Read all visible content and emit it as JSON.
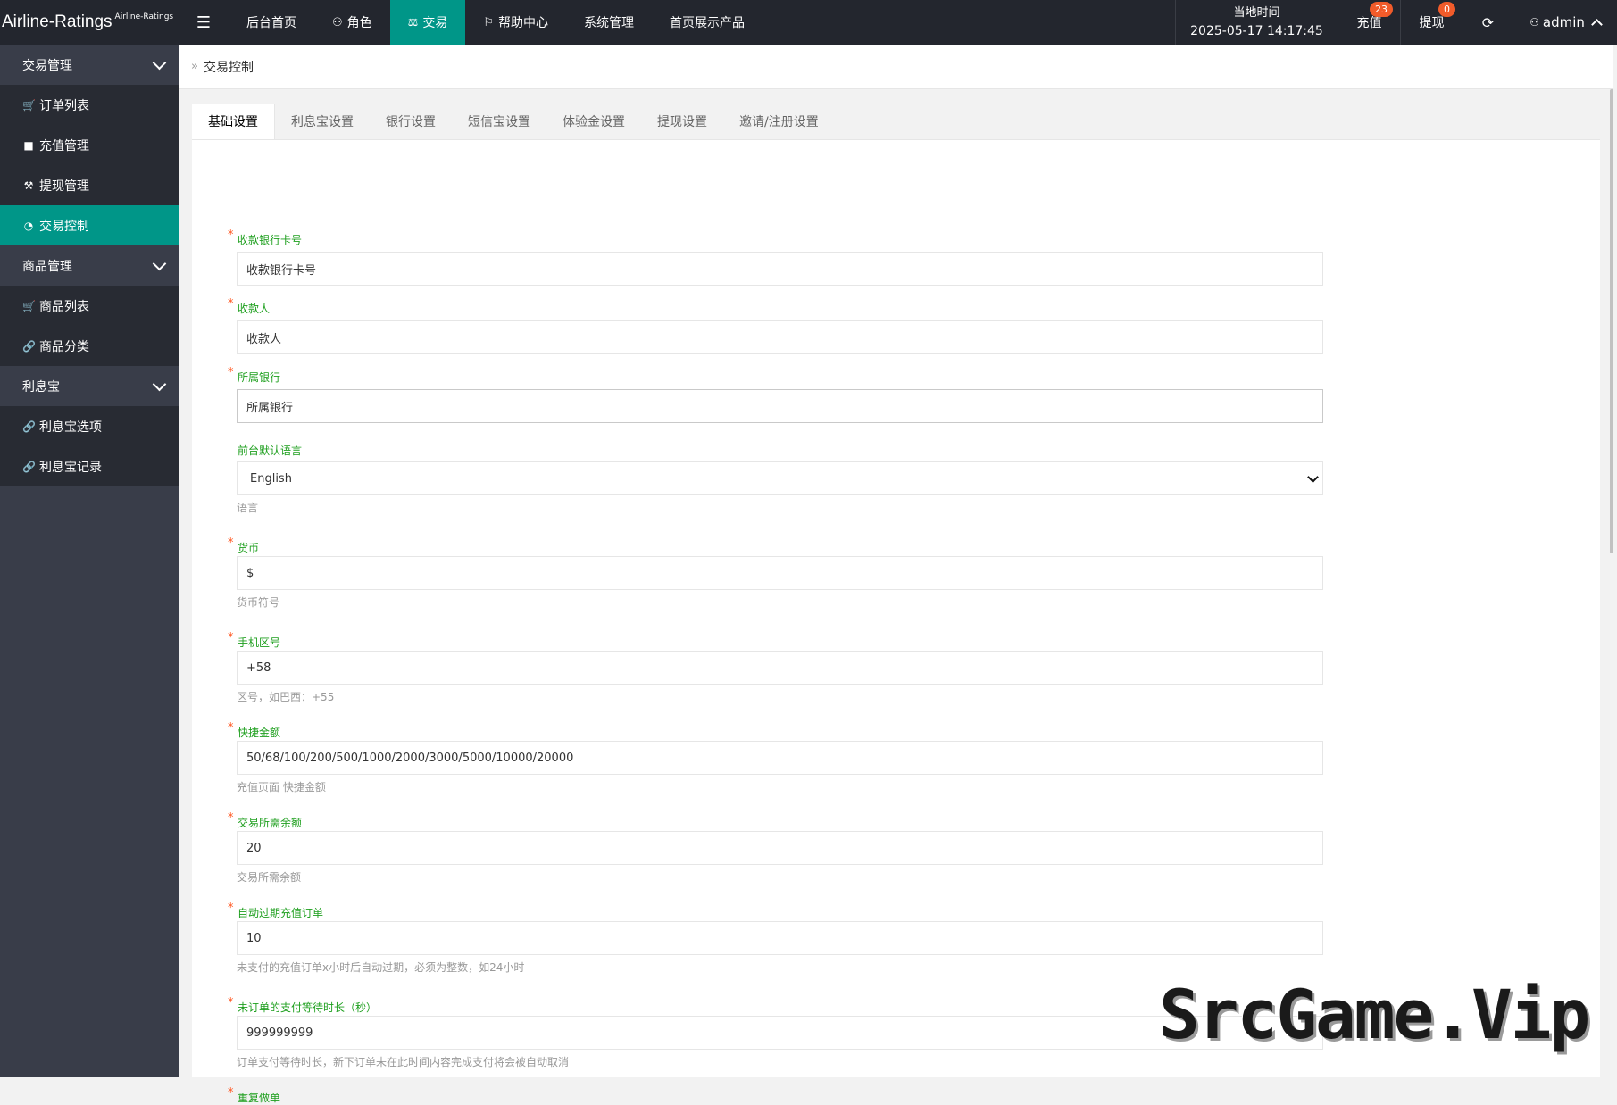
{
  "brand": {
    "name": "Airline-Ratings",
    "sub": "Airline-Ratings"
  },
  "topnav": [
    {
      "label": "后台首页",
      "icon": ""
    },
    {
      "label": "角色",
      "icon": "user-icon"
    },
    {
      "label": "交易",
      "icon": "scale-icon",
      "active": true
    },
    {
      "label": "帮助中心",
      "icon": "flag-icon"
    },
    {
      "label": "系统管理",
      "icon": ""
    },
    {
      "label": "首页展示产品",
      "icon": ""
    }
  ],
  "header": {
    "time_label": "当地时间",
    "time_value": "2025-05-17 14:17:45",
    "recharge_label": "充值",
    "recharge_count": "23",
    "withdraw_label": "提现",
    "withdraw_count": "0",
    "user": "admin"
  },
  "sidebar": {
    "groups": [
      {
        "label": "交易管理",
        "items": [
          {
            "label": "订单列表",
            "icon": "cart-icon"
          },
          {
            "label": "充值管理",
            "icon": "comment-icon"
          },
          {
            "label": "提现管理",
            "icon": "gavel-icon"
          },
          {
            "label": "交易控制",
            "icon": "gauge-icon",
            "active": true
          }
        ]
      },
      {
        "label": "商品管理",
        "items": [
          {
            "label": "商品列表",
            "icon": "cart-icon"
          },
          {
            "label": "商品分类",
            "icon": "link-icon"
          }
        ]
      },
      {
        "label": "利息宝",
        "items": [
          {
            "label": "利息宝选项",
            "icon": "link-icon"
          },
          {
            "label": "利息宝记录",
            "icon": "link-icon"
          }
        ]
      }
    ]
  },
  "breadcrumb": {
    "current": "交易控制"
  },
  "tabs": [
    "基础设置",
    "利息宝设置",
    "银行设置",
    "短信宝设置",
    "体验金设置",
    "提现设置",
    "邀请/注册设置"
  ],
  "form": {
    "fields": [
      {
        "label": "收款银行卡号",
        "value": "收款银行卡号",
        "required": true,
        "hint": ""
      },
      {
        "label": "收款人",
        "value": "收款人",
        "required": true,
        "hint": ""
      },
      {
        "label": "所属银行",
        "value": "所属银行",
        "required": true,
        "hint": ""
      },
      {
        "label": "前台默认语言",
        "value": "English",
        "required": false,
        "hint": "语言",
        "type": "select"
      },
      {
        "label": "货币",
        "value": "$",
        "required": true,
        "hint": "货币符号"
      },
      {
        "label": "手机区号",
        "value": "+58",
        "required": true,
        "hint": "区号，如巴西：+55"
      },
      {
        "label": "快捷金额",
        "value": "50/68/100/200/500/1000/2000/3000/5000/10000/20000",
        "required": true,
        "hint": "充值页面 快捷金额"
      },
      {
        "label": "交易所需余额",
        "value": "20",
        "required": true,
        "hint": "交易所需余额"
      },
      {
        "label": "自动过期充值订单",
        "value": "10",
        "required": true,
        "hint": "未支付的充值订单x小时后自动过期，必须为整数，如24小时"
      },
      {
        "label": "未订单的支付等待时长（秒）",
        "value": "999999999",
        "required": true,
        "hint": "订单支付等待时长，新下订单未在此时间内容完成支付将会被自动取消"
      },
      {
        "label": "重复做单",
        "value": "",
        "required": true,
        "hint": ""
      }
    ]
  },
  "watermark": "SrcGame.Vip"
}
